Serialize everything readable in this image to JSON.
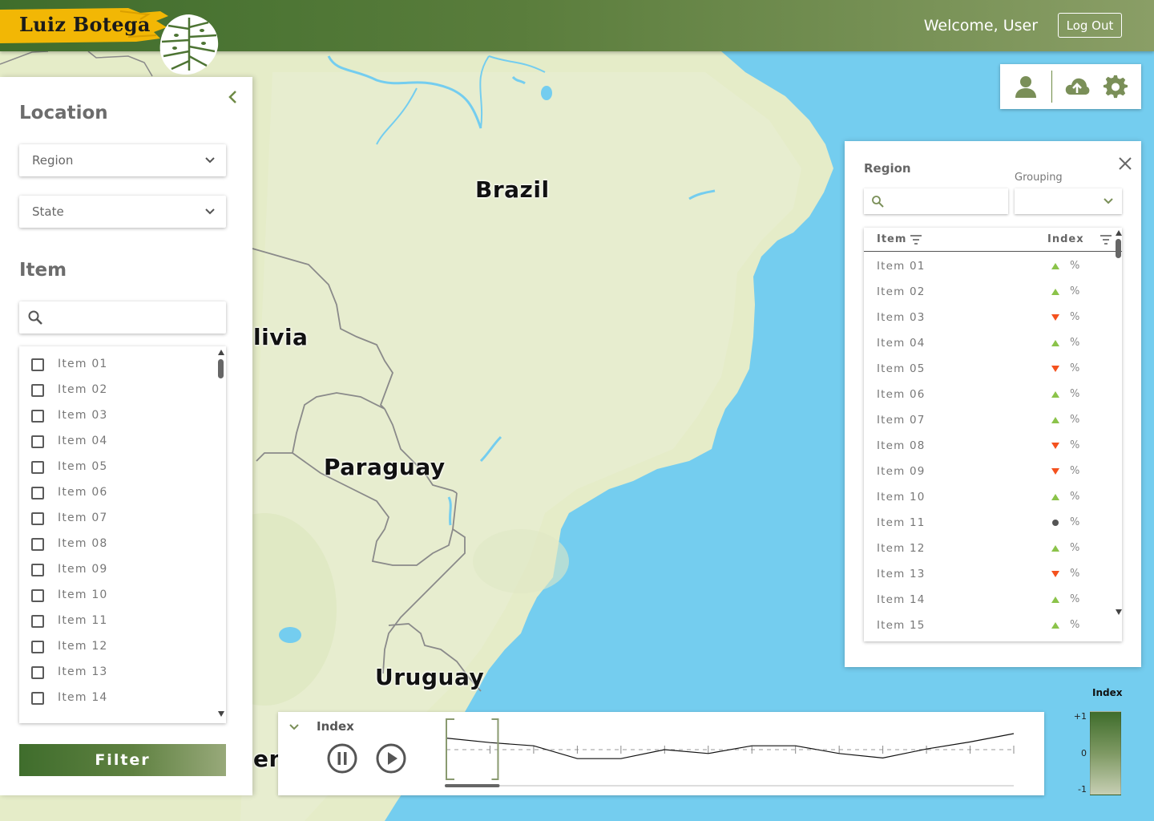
{
  "header": {
    "brand": "Luiz Botega",
    "welcome": "Welcome, User",
    "logout_label": "Log Out"
  },
  "map": {
    "labels": {
      "brazil": "Brazil",
      "bolivia": "livia",
      "paraguay": "Paraguay",
      "uruguay": "Uruguay",
      "argentina": "en"
    }
  },
  "left_panel": {
    "location_title": "Location",
    "region_select": "Region",
    "state_select": "State",
    "item_title": "Item",
    "search_placeholder": "",
    "items": [
      "Item 01",
      "Item 02",
      "Item 03",
      "Item 04",
      "Item 05",
      "Item 06",
      "Item 07",
      "Item 08",
      "Item 09",
      "Item 10",
      "Item 11",
      "Item 12",
      "Item 13",
      "Item 14"
    ],
    "filter_label": "Filter"
  },
  "toolbar": {
    "icons": [
      "user-icon",
      "cloud-upload-icon",
      "settings-gear-icon"
    ]
  },
  "right_panel": {
    "title": "Region",
    "grouping_label": "Grouping",
    "grouping_value": "",
    "search_placeholder": "",
    "columns": {
      "item": "Item",
      "index": "Index"
    },
    "rows": [
      {
        "name": "Item 01",
        "trend": "up",
        "pct": "%"
      },
      {
        "name": "Item 02",
        "trend": "up",
        "pct": "%"
      },
      {
        "name": "Item 03",
        "trend": "down",
        "pct": "%"
      },
      {
        "name": "Item 04",
        "trend": "up",
        "pct": "%"
      },
      {
        "name": "Item 05",
        "trend": "down",
        "pct": "%"
      },
      {
        "name": "Item 06",
        "trend": "up",
        "pct": "%"
      },
      {
        "name": "Item 07",
        "trend": "up",
        "pct": "%"
      },
      {
        "name": "Item 08",
        "trend": "down",
        "pct": "%"
      },
      {
        "name": "Item 09",
        "trend": "down",
        "pct": "%"
      },
      {
        "name": "Item 10",
        "trend": "up",
        "pct": "%"
      },
      {
        "name": "Item 11",
        "trend": "neutral",
        "pct": "%"
      },
      {
        "name": "Item 12",
        "trend": "up",
        "pct": "%"
      },
      {
        "name": "Item 13",
        "trend": "down",
        "pct": "%"
      },
      {
        "name": "Item 14",
        "trend": "up",
        "pct": "%"
      },
      {
        "name": "Item 15",
        "trend": "up",
        "pct": "%"
      }
    ],
    "colors": {
      "up": "#8bc34a",
      "down": "#f4511e",
      "neutral": "#555555"
    }
  },
  "timeline": {
    "title": "Index",
    "controls": [
      "pause-icon",
      "play-icon"
    ],
    "series": [
      0.9,
      0.55,
      0.3,
      -0.7,
      -0.7,
      0.0,
      -0.3,
      0.3,
      0.3,
      -0.3,
      -0.65,
      0.05,
      0.6,
      1.25
    ],
    "selection_start_index": 0,
    "selection_end_index": 1
  },
  "legend": {
    "title": "Index",
    "max": "+1",
    "mid": "0",
    "min": "-1",
    "colors": {
      "high": "#3f6d2c",
      "low": "#c7cfb4"
    }
  },
  "colors": {
    "brand_green": "#3f6d2c",
    "accent_green": "#6e8a45",
    "water": "#74cdef",
    "land": "#e5ecc8"
  }
}
